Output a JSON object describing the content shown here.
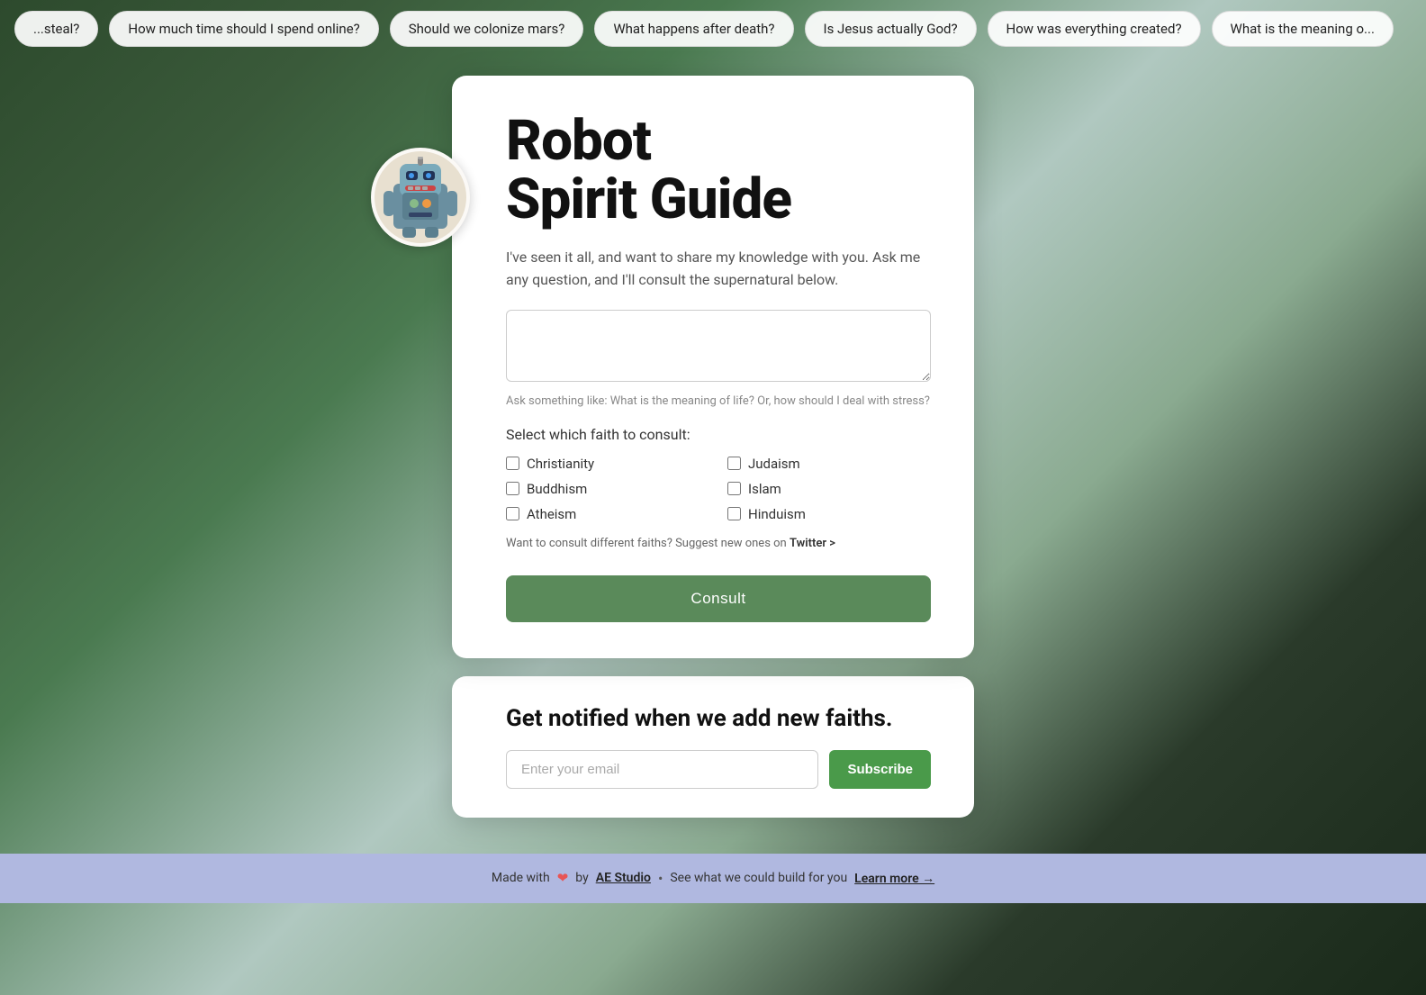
{
  "tags": [
    {
      "id": "steal",
      "label": "...steal?"
    },
    {
      "id": "time-online",
      "label": "How much time should I spend online?"
    },
    {
      "id": "colonize-mars",
      "label": "Should we colonize mars?"
    },
    {
      "id": "after-death",
      "label": "What happens after death?"
    },
    {
      "id": "jesus-god",
      "label": "Is Jesus actually God?"
    },
    {
      "id": "everything-created",
      "label": "How was everything created?"
    },
    {
      "id": "meaning",
      "label": "What is the meaning o..."
    }
  ],
  "card": {
    "title_line1": "Robot",
    "title_line2": "Spirit Guide",
    "description": "I've seen it all, and want to share my knowledge with you. Ask me any question, and I'll consult the supernatural below.",
    "textarea_placeholder": "",
    "hint": "Ask something like: What is the meaning of life? Or, how should I deal with stress?",
    "faith_label": "Select which faith to consult:",
    "faiths": [
      {
        "id": "christianity",
        "label": "Christianity"
      },
      {
        "id": "judaism",
        "label": "Judaism"
      },
      {
        "id": "buddhism",
        "label": "Buddhism"
      },
      {
        "id": "islam",
        "label": "Islam"
      },
      {
        "id": "atheism",
        "label": "Atheism"
      },
      {
        "id": "hinduism",
        "label": "Hinduism"
      }
    ],
    "suggest_text": "Want to consult different faiths? Suggest new ones on",
    "twitter_link": "Twitter >",
    "consult_button": "Consult"
  },
  "notify": {
    "title": "Get notified when we add new faiths.",
    "email_placeholder": "Enter your email",
    "subscribe_button": "Subscribe"
  },
  "footer": {
    "made_with": "Made with",
    "by": "by",
    "studio_name": "AE Studio",
    "see_text": "See what we could build for you",
    "learn_more": "Learn more →",
    "bullet": "•"
  }
}
